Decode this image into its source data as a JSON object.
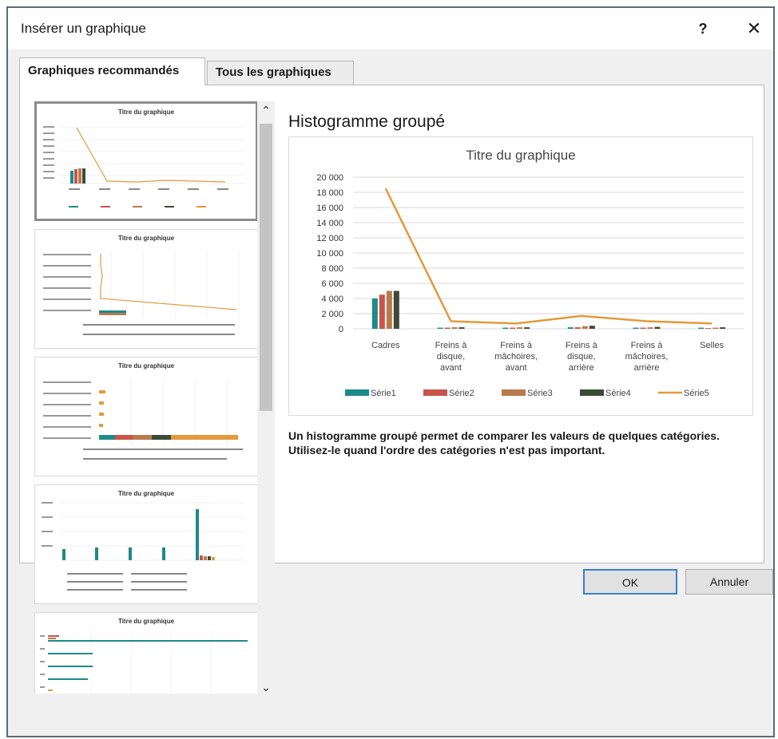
{
  "window": {
    "title": "Insérer un graphique",
    "help": "?",
    "close": "✕"
  },
  "tabs": [
    {
      "label": "Graphiques recommandés",
      "active": true
    },
    {
      "label": "Tous les graphiques",
      "active": false
    }
  ],
  "thumbnails": [
    {
      "title": "Titre du graphique",
      "kind": "combo"
    },
    {
      "title": "Titre du graphique",
      "kind": "horizontal-line"
    },
    {
      "title": "Titre du graphique",
      "kind": "stacked-bar"
    },
    {
      "title": "Titre du graphique",
      "kind": "column-by-series"
    },
    {
      "title": "Titre du graphique",
      "kind": "bar"
    }
  ],
  "preview": {
    "heading": "Histogramme groupé",
    "description": "Un histogramme groupé permet de comparer les valeurs de quelques catégories. Utilisez-le quand l'ordre des catégories n'est pas important."
  },
  "buttons": {
    "ok": "OK",
    "cancel": "Annuler"
  },
  "colors": {
    "serie1": "#1e8a8a",
    "serie2": "#c9544a",
    "serie3": "#b97a4c",
    "serie4": "#3e4a38",
    "serie5": "#e39a3b",
    "accent": "#3c7fc7"
  },
  "chart_data": {
    "type": "bar",
    "title": "Titre du graphique",
    "categories": [
      [
        "Cadres"
      ],
      [
        "Freins à",
        "disque,",
        "avant"
      ],
      [
        "Freins à",
        "mâchoires,",
        "avant"
      ],
      [
        "Freins à",
        "disque,",
        "arrière"
      ],
      [
        "Freins à",
        "mâchoires,",
        "arrière"
      ],
      [
        "Selles"
      ]
    ],
    "series": [
      {
        "name": "Série1",
        "type": "bar",
        "color": "#1e8a8a",
        "values": [
          4000,
          150,
          150,
          200,
          150,
          150
        ]
      },
      {
        "name": "Série2",
        "type": "bar",
        "color": "#c9544a",
        "values": [
          4500,
          150,
          150,
          200,
          150,
          100
        ]
      },
      {
        "name": "Série3",
        "type": "bar",
        "color": "#b97a4c",
        "values": [
          5000,
          200,
          200,
          350,
          200,
          150
        ]
      },
      {
        "name": "Série4",
        "type": "bar",
        "color": "#3e4a38",
        "values": [
          5000,
          200,
          200,
          400,
          250,
          200
        ]
      },
      {
        "name": "Série5",
        "type": "line",
        "color": "#e39a3b",
        "values": [
          18500,
          1000,
          700,
          1700,
          1000,
          700
        ]
      }
    ],
    "ylim": [
      0,
      20000
    ],
    "yticks": [
      "0",
      "2 000",
      "4 000",
      "6 000",
      "8 000",
      "10 000",
      "12 000",
      "14 000",
      "16 000",
      "18 000",
      "20 000"
    ],
    "legend": "bottom",
    "grid": true
  }
}
